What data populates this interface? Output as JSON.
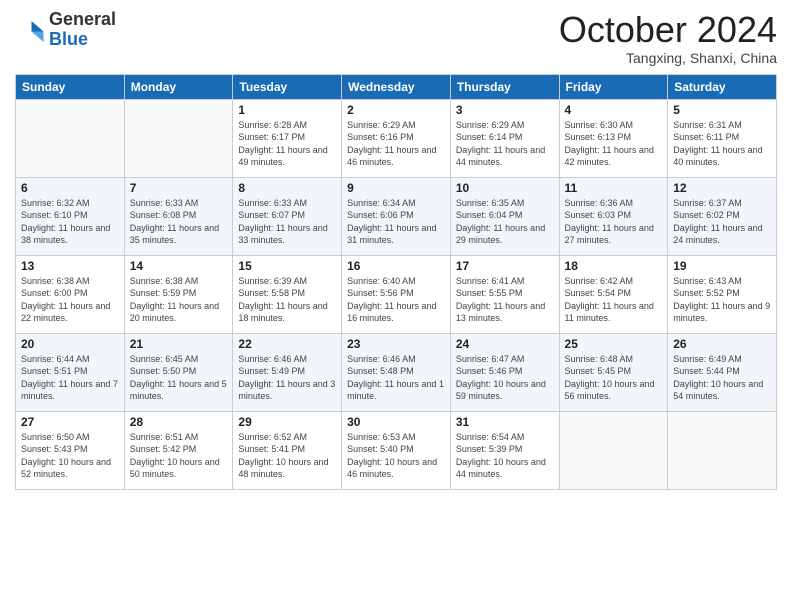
{
  "header": {
    "logo_general": "General",
    "logo_blue": "Blue",
    "month_title": "October 2024",
    "subtitle": "Tangxing, Shanxi, China"
  },
  "days_of_week": [
    "Sunday",
    "Monday",
    "Tuesday",
    "Wednesday",
    "Thursday",
    "Friday",
    "Saturday"
  ],
  "weeks": [
    [
      {
        "day": "",
        "info": ""
      },
      {
        "day": "",
        "info": ""
      },
      {
        "day": "1",
        "info": "Sunrise: 6:28 AM\nSunset: 6:17 PM\nDaylight: 11 hours and 49 minutes."
      },
      {
        "day": "2",
        "info": "Sunrise: 6:29 AM\nSunset: 6:16 PM\nDaylight: 11 hours and 46 minutes."
      },
      {
        "day": "3",
        "info": "Sunrise: 6:29 AM\nSunset: 6:14 PM\nDaylight: 11 hours and 44 minutes."
      },
      {
        "day": "4",
        "info": "Sunrise: 6:30 AM\nSunset: 6:13 PM\nDaylight: 11 hours and 42 minutes."
      },
      {
        "day": "5",
        "info": "Sunrise: 6:31 AM\nSunset: 6:11 PM\nDaylight: 11 hours and 40 minutes."
      }
    ],
    [
      {
        "day": "6",
        "info": "Sunrise: 6:32 AM\nSunset: 6:10 PM\nDaylight: 11 hours and 38 minutes."
      },
      {
        "day": "7",
        "info": "Sunrise: 6:33 AM\nSunset: 6:08 PM\nDaylight: 11 hours and 35 minutes."
      },
      {
        "day": "8",
        "info": "Sunrise: 6:33 AM\nSunset: 6:07 PM\nDaylight: 11 hours and 33 minutes."
      },
      {
        "day": "9",
        "info": "Sunrise: 6:34 AM\nSunset: 6:06 PM\nDaylight: 11 hours and 31 minutes."
      },
      {
        "day": "10",
        "info": "Sunrise: 6:35 AM\nSunset: 6:04 PM\nDaylight: 11 hours and 29 minutes."
      },
      {
        "day": "11",
        "info": "Sunrise: 6:36 AM\nSunset: 6:03 PM\nDaylight: 11 hours and 27 minutes."
      },
      {
        "day": "12",
        "info": "Sunrise: 6:37 AM\nSunset: 6:02 PM\nDaylight: 11 hours and 24 minutes."
      }
    ],
    [
      {
        "day": "13",
        "info": "Sunrise: 6:38 AM\nSunset: 6:00 PM\nDaylight: 11 hours and 22 minutes."
      },
      {
        "day": "14",
        "info": "Sunrise: 6:38 AM\nSunset: 5:59 PM\nDaylight: 11 hours and 20 minutes."
      },
      {
        "day": "15",
        "info": "Sunrise: 6:39 AM\nSunset: 5:58 PM\nDaylight: 11 hours and 18 minutes."
      },
      {
        "day": "16",
        "info": "Sunrise: 6:40 AM\nSunset: 5:56 PM\nDaylight: 11 hours and 16 minutes."
      },
      {
        "day": "17",
        "info": "Sunrise: 6:41 AM\nSunset: 5:55 PM\nDaylight: 11 hours and 13 minutes."
      },
      {
        "day": "18",
        "info": "Sunrise: 6:42 AM\nSunset: 5:54 PM\nDaylight: 11 hours and 11 minutes."
      },
      {
        "day": "19",
        "info": "Sunrise: 6:43 AM\nSunset: 5:52 PM\nDaylight: 11 hours and 9 minutes."
      }
    ],
    [
      {
        "day": "20",
        "info": "Sunrise: 6:44 AM\nSunset: 5:51 PM\nDaylight: 11 hours and 7 minutes."
      },
      {
        "day": "21",
        "info": "Sunrise: 6:45 AM\nSunset: 5:50 PM\nDaylight: 11 hours and 5 minutes."
      },
      {
        "day": "22",
        "info": "Sunrise: 6:46 AM\nSunset: 5:49 PM\nDaylight: 11 hours and 3 minutes."
      },
      {
        "day": "23",
        "info": "Sunrise: 6:46 AM\nSunset: 5:48 PM\nDaylight: 11 hours and 1 minute."
      },
      {
        "day": "24",
        "info": "Sunrise: 6:47 AM\nSunset: 5:46 PM\nDaylight: 10 hours and 59 minutes."
      },
      {
        "day": "25",
        "info": "Sunrise: 6:48 AM\nSunset: 5:45 PM\nDaylight: 10 hours and 56 minutes."
      },
      {
        "day": "26",
        "info": "Sunrise: 6:49 AM\nSunset: 5:44 PM\nDaylight: 10 hours and 54 minutes."
      }
    ],
    [
      {
        "day": "27",
        "info": "Sunrise: 6:50 AM\nSunset: 5:43 PM\nDaylight: 10 hours and 52 minutes."
      },
      {
        "day": "28",
        "info": "Sunrise: 6:51 AM\nSunset: 5:42 PM\nDaylight: 10 hours and 50 minutes."
      },
      {
        "day": "29",
        "info": "Sunrise: 6:52 AM\nSunset: 5:41 PM\nDaylight: 10 hours and 48 minutes."
      },
      {
        "day": "30",
        "info": "Sunrise: 6:53 AM\nSunset: 5:40 PM\nDaylight: 10 hours and 46 minutes."
      },
      {
        "day": "31",
        "info": "Sunrise: 6:54 AM\nSunset: 5:39 PM\nDaylight: 10 hours and 44 minutes."
      },
      {
        "day": "",
        "info": ""
      },
      {
        "day": "",
        "info": ""
      }
    ]
  ]
}
